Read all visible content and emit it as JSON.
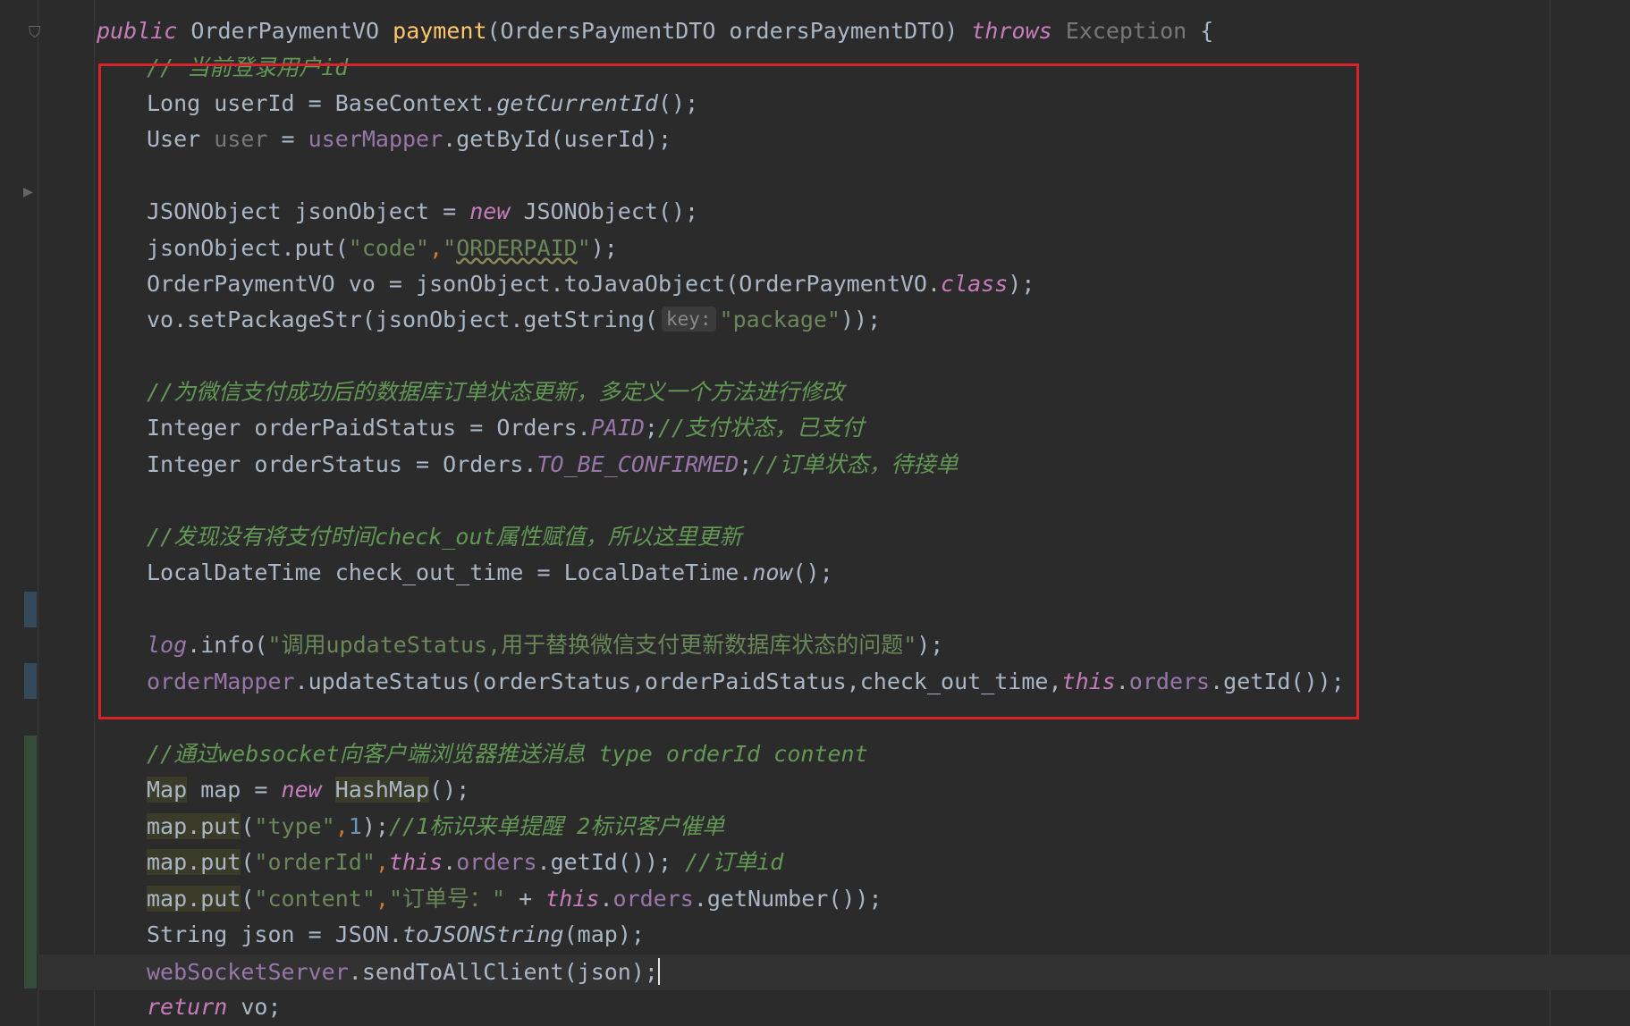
{
  "code": {
    "line1": {
      "kw1": "public",
      "type1": " OrderPaymentVO ",
      "method": "payment",
      "params": "(OrdersPaymentDTO ordersPaymentDTO) ",
      "kw2": "throws",
      "exception": " Exception",
      "brace": " {"
    },
    "line2": {
      "comment": "// 当前登录用户id"
    },
    "line3": {
      "a": "Long userId = BaseContext.",
      "b": "getCurrentId",
      "c": "();"
    },
    "line4": {
      "a": "User ",
      "b": "user",
      "c": " = ",
      "d": "userMapper",
      "e": ".getById(userId);"
    },
    "line6": {
      "a": "JSONObject jsonObject = ",
      "kw": "new",
      "b": " JSONObject();"
    },
    "line7": {
      "a": "jsonObject.put(",
      "s1": "\"code\"",
      "comma": ",",
      "s2a": "\"",
      "s2b": "ORDERPAID",
      "s2c": "\"",
      "b": ");"
    },
    "line8": {
      "a": "OrderPaymentVO vo = jsonObject.toJavaObject(OrderPaymentVO.",
      "kw": "class",
      "b": ");"
    },
    "line9": {
      "a": "vo.setPackageStr(jsonObject.getString(",
      "hint": "key:",
      "s": "\"package\"",
      "b": "));"
    },
    "line11": {
      "comment": "//为微信支付成功后的数据库订单状态更新，多定义一个方法进行修改"
    },
    "line12": {
      "a": "Integer orderPaidStatus = Orders.",
      "f": "PAID",
      "b": ";",
      "c": "//支付状态，已支付"
    },
    "line13": {
      "a": "Integer orderStatus = Orders.",
      "f": "TO_BE_CONFIRMED",
      "b": ";",
      "c": "//订单状态，待接单"
    },
    "line15": {
      "comment": "//发现没有将支付时间check_out属性赋值，所以这里更新"
    },
    "line16": {
      "a": "LocalDateTime check_out_time = LocalDateTime.",
      "b": "now",
      "c": "();"
    },
    "line18": {
      "a": "log",
      "b": ".info(",
      "s": "\"调用updateStatus,用于替换微信支付更新数据库状态的问题\"",
      "c": ");"
    },
    "line19": {
      "a": "orderMapper",
      "b": ".updateStatus(orderStatus,orderPaidStatus,check_out_time,",
      "kw": "this",
      "c": ".",
      "f": "orders",
      "d": ".getId());"
    },
    "line21": {
      "comment": "//通过websocket向客户端浏览器推送消息 type orderId content"
    },
    "line22": {
      "a": "Map",
      "b": " map = ",
      "kw": "new",
      "c": " ",
      "d": "HashMap",
      "e": "();"
    },
    "line23": {
      "a": "map.put",
      "b": "(",
      "s": "\"type\"",
      "c": ",",
      "n": "1",
      "d": ");",
      "cm": "//1标识来单提醒 2标识客户催单"
    },
    "line24": {
      "a": "map.put",
      "b": "(",
      "s": "\"orderId\"",
      "c": ",",
      "kw": "this",
      "d": ".",
      "f": "orders",
      "e": ".getId()); ",
      "cm": "//订单id"
    },
    "line25": {
      "a": "map.put",
      "b": "(",
      "s": "\"content\"",
      "c": ",",
      "s2": "\"订单号：\"",
      "d": " + ",
      "kw": "this",
      "e": ".",
      "f": "orders",
      "g": ".getNumber());"
    },
    "line26": {
      "a": "String json = JSON.",
      "b": "toJSONString",
      "c": "(map);"
    },
    "line27": {
      "a": "webSocketServer",
      "b": ".sendToAllClient(json);"
    },
    "line28": {
      "kw": "return",
      "a": " vo;"
    }
  },
  "colors": {
    "background": "#2b2b2b",
    "highlight_box": "#d8232a"
  },
  "icons": {
    "fold": "fold-marker-icon",
    "run": "run-arrow-icon"
  }
}
